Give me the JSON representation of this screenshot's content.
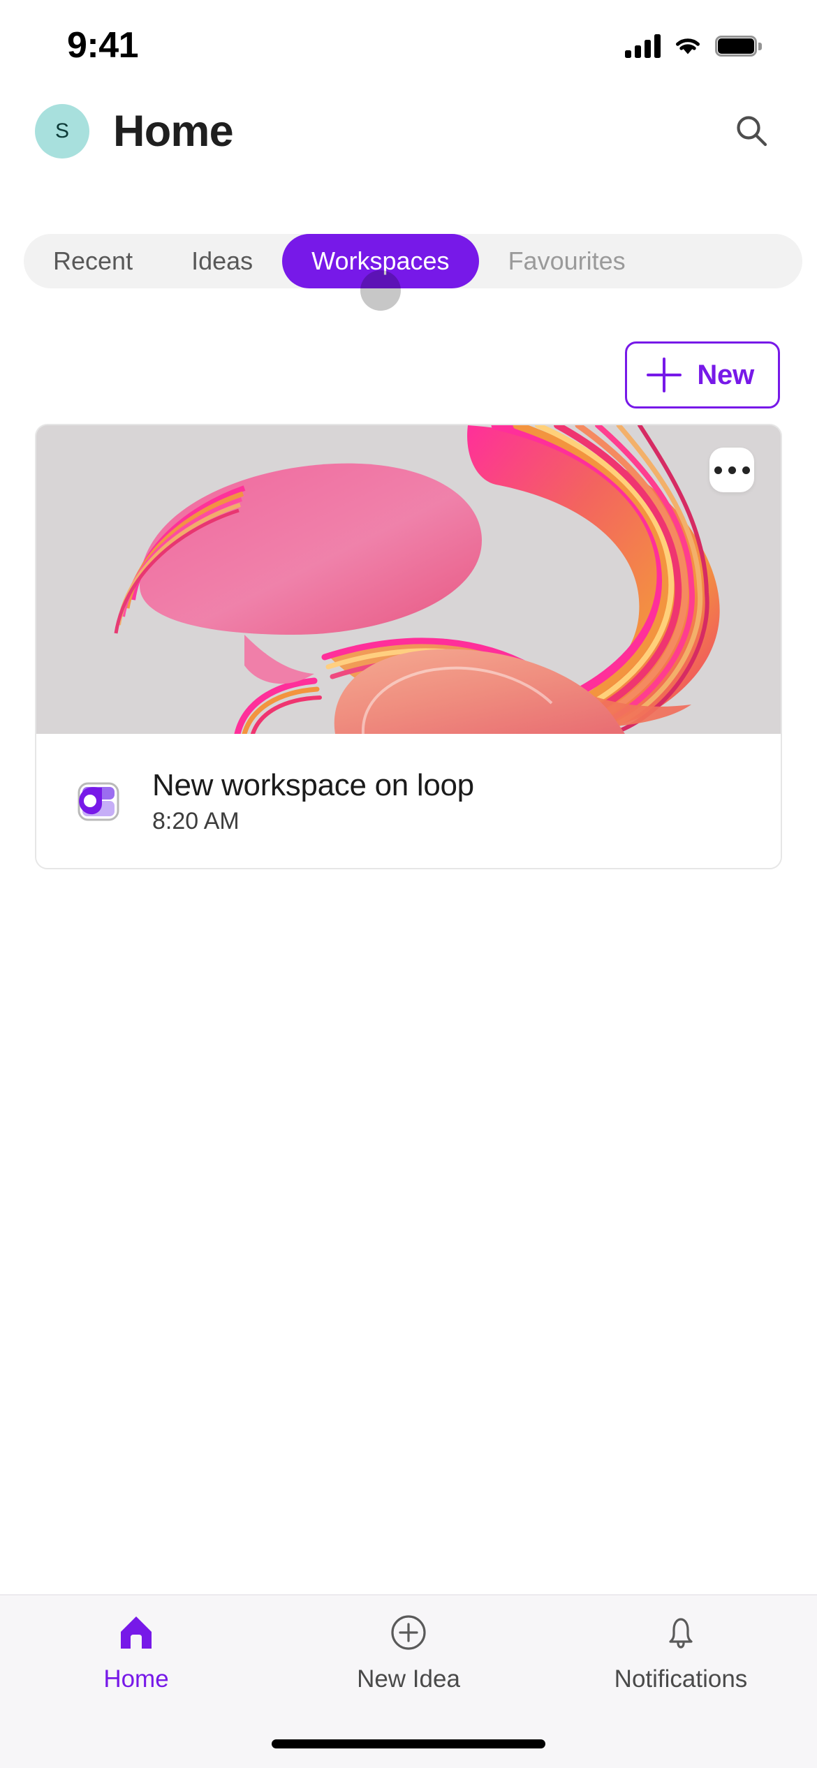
{
  "status_bar": {
    "time": "9:41",
    "icons": [
      "cellular-signal-icon",
      "wifi-icon",
      "battery-icon"
    ]
  },
  "header": {
    "avatar_initial": "S",
    "title": "Home",
    "search_icon": "search-icon"
  },
  "tabs": {
    "items": [
      {
        "label": "Recent",
        "active": false
      },
      {
        "label": "Ideas",
        "active": false
      },
      {
        "label": "Workspaces",
        "active": true
      },
      {
        "label": "Favourites",
        "active": false
      }
    ],
    "active_index": 2
  },
  "actions": {
    "new_label": "New",
    "new_icon": "plus-icon"
  },
  "workspace_card": {
    "more_icon": "more-horizontal-icon",
    "app_icon": "loop-app-icon",
    "title": "New workspace on loop",
    "timestamp": "8:20 AM",
    "art_alt": "abstract-ribbon-artwork"
  },
  "bottom_nav": {
    "items": [
      {
        "label": "Home",
        "icon": "home-icon",
        "active": true
      },
      {
        "label": "New Idea",
        "icon": "plus-circle-icon",
        "active": false
      },
      {
        "label": "Notifications",
        "icon": "bell-icon",
        "active": false
      }
    ]
  },
  "colors": {
    "accent": "#7719e8",
    "avatar_bg": "#a8e0dd",
    "tab_track": "#f2f2f2",
    "nav_bg": "#f7f6f8",
    "card_art_bg": "#d8d5d6",
    "text_primary": "#1f1f1f",
    "text_secondary": "#585858"
  }
}
